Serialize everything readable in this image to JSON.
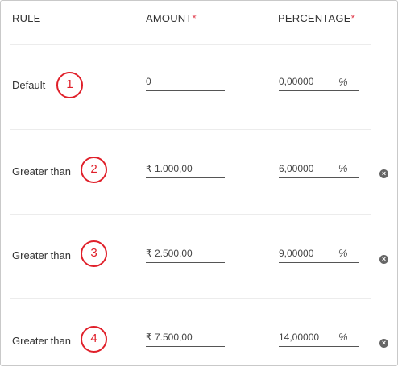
{
  "header": {
    "rule": "RULE",
    "amount": "AMOUNT",
    "percentage": "PERCENTAGE",
    "required_mark": "*"
  },
  "rows": [
    {
      "rule": "Default",
      "badge": "1",
      "amount": "0",
      "percentage": "0,00000",
      "percent_symbol": "%",
      "removable": false
    },
    {
      "rule": "Greater than",
      "badge": "2",
      "amount": "₹ 1.000,00",
      "percentage": "6,00000",
      "percent_symbol": "%",
      "removable": true
    },
    {
      "rule": "Greater than",
      "badge": "3",
      "amount": "₹ 2.500,00",
      "percentage": "9,00000",
      "percent_symbol": "%",
      "removable": true
    },
    {
      "rule": "Greater than",
      "badge": "4",
      "amount": "₹ 7.500,00",
      "percentage": "14,00000",
      "percent_symbol": "%",
      "removable": true
    }
  ],
  "icons": {
    "remove": "remove-circle-icon"
  },
  "colors": {
    "required": "#e03a4a",
    "badge": "#e0202a"
  }
}
